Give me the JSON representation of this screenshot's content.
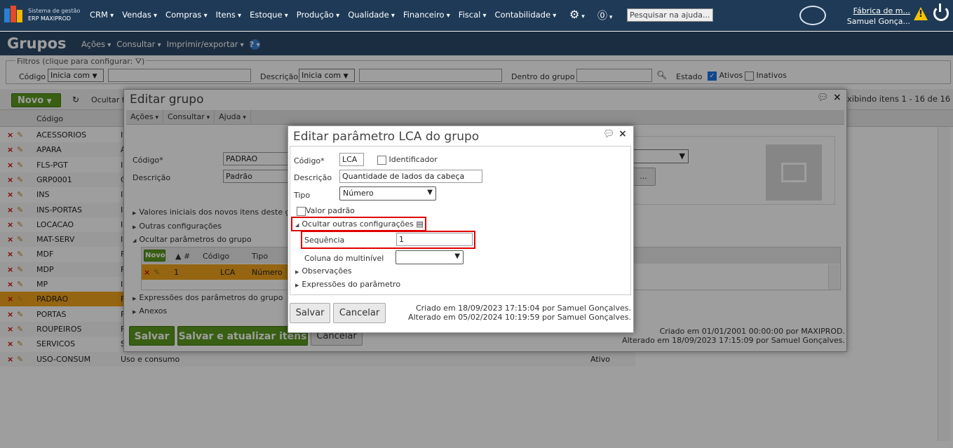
{
  "header": {
    "system_label": "Sistema de gestão",
    "system_name": "ERP MAXIPROD",
    "menu": [
      "CRM",
      "Vendas",
      "Compras",
      "Itens",
      "Estoque",
      "Produção",
      "Qualidade",
      "Financeiro",
      "Fiscal",
      "Contabilidade"
    ],
    "help_search_placeholder": "Pesquisar na ajuda...",
    "company": "Fábrica de m...",
    "user": "Samuel Gonça..."
  },
  "page": {
    "title": "Grupos",
    "menu": [
      "Ações",
      "Consultar",
      "Imprimir/exportar"
    ]
  },
  "filters": {
    "legend": "Filtros (clique para configurar:",
    "code_label": "Código",
    "code_op": "Inicia com",
    "desc_label": "Descrição",
    "desc_op": "Inicia com",
    "group_label": "Dentro do grupo",
    "state_label": "Estado",
    "active_label": "Ativos",
    "inactive_label": "Inativos"
  },
  "toolbar": {
    "new_label": "Novo",
    "hide_label": "Ocultar f",
    "showing": "xibindo itens 1 - 16 de 16"
  },
  "grid": {
    "col_code": "Código",
    "rows": [
      {
        "code": "ACESSORIOS",
        "desc": "I",
        "state": ""
      },
      {
        "code": "APARA",
        "desc": "A",
        "state": ""
      },
      {
        "code": "FLS-PGT",
        "desc": "I",
        "state": ""
      },
      {
        "code": "GRP0001",
        "desc": "C",
        "state": ""
      },
      {
        "code": "INS",
        "desc": "I",
        "state": ""
      },
      {
        "code": "INS-PORTAS",
        "desc": "I",
        "state": ""
      },
      {
        "code": "LOCACAO",
        "desc": "I",
        "state": ""
      },
      {
        "code": "MAT-SERV",
        "desc": "I",
        "state": ""
      },
      {
        "code": "MDF",
        "desc": "F",
        "state": ""
      },
      {
        "code": "MDP",
        "desc": "F",
        "state": ""
      },
      {
        "code": "MP",
        "desc": "I",
        "state": ""
      },
      {
        "code": "PADRAO",
        "desc": "F",
        "state": ""
      },
      {
        "code": "PORTAS",
        "desc": "F",
        "state": ""
      },
      {
        "code": "ROUPEIROS",
        "desc": "F",
        "state": ""
      },
      {
        "code": "SERVICOS",
        "desc": "S",
        "state": ""
      },
      {
        "code": "USO-CONSUM",
        "desc": "Uso e consumo",
        "state": "Ativo"
      }
    ]
  },
  "edit_group": {
    "title": "Editar grupo",
    "menu": [
      "Ações",
      "Consultar",
      "Ajuda"
    ],
    "code_label": "Código*",
    "code_value": "PADRAO",
    "desc_label": "Descrição",
    "desc_value": "Padrão",
    "browse_label": "...",
    "sections": {
      "initial_values": "Valores iniciais dos novos itens deste g",
      "other_config": "Outras configurações",
      "hide_params": "Ocultar parâmetros do grupo",
      "expressions": "Expressões dos parâmetros do grupo",
      "attachments": "Anexos"
    },
    "param_grid": {
      "new_label": "Novo",
      "col_sort": "▲ #",
      "col_code": "Código",
      "col_type": "Tipo",
      "row": {
        "num": "1",
        "code": "LCA",
        "type": "Número"
      }
    },
    "save_label": "Salvar",
    "save_update_label": "Salvar e atualizar itens",
    "cancel_label": "Cancelar",
    "created": "Criado em 01/01/2001 00:00:00 por MAXIPROD.",
    "modified": "Alterado em 18/09/2023 17:15:09 por Samuel Gonçalves."
  },
  "edit_param": {
    "title": "Editar parâmetro LCA do grupo",
    "code_label": "Código*",
    "code_value": "LCA",
    "identifier_label": "Identificador",
    "desc_label": "Descrição",
    "desc_value": "Quantidade de lados da cabeça",
    "type_label": "Tipo",
    "type_value": "Número",
    "default_label": "Valor padrão",
    "hide_other_label": "Ocultar outras configurações",
    "sequence_label": "Sequência",
    "sequence_value": "1",
    "multilevel_label": "Coluna do multinível",
    "observations_label": "Observações",
    "expressions_label": "Expressões do parâmetro",
    "save_label": "Salvar",
    "cancel_label": "Cancelar",
    "created": "Criado em 18/09/2023 17:15:04 por Samuel Gonçalves.",
    "modified": "Alterado em 05/02/2024 10:19:59 por Samuel Gonçalves."
  },
  "colors": {
    "topbar": "#1e3a56",
    "titlebar": "#2c4a68",
    "green": "#5b9a1e",
    "highlight_row": "#f0a41c",
    "red_highlight": "#e00000"
  }
}
